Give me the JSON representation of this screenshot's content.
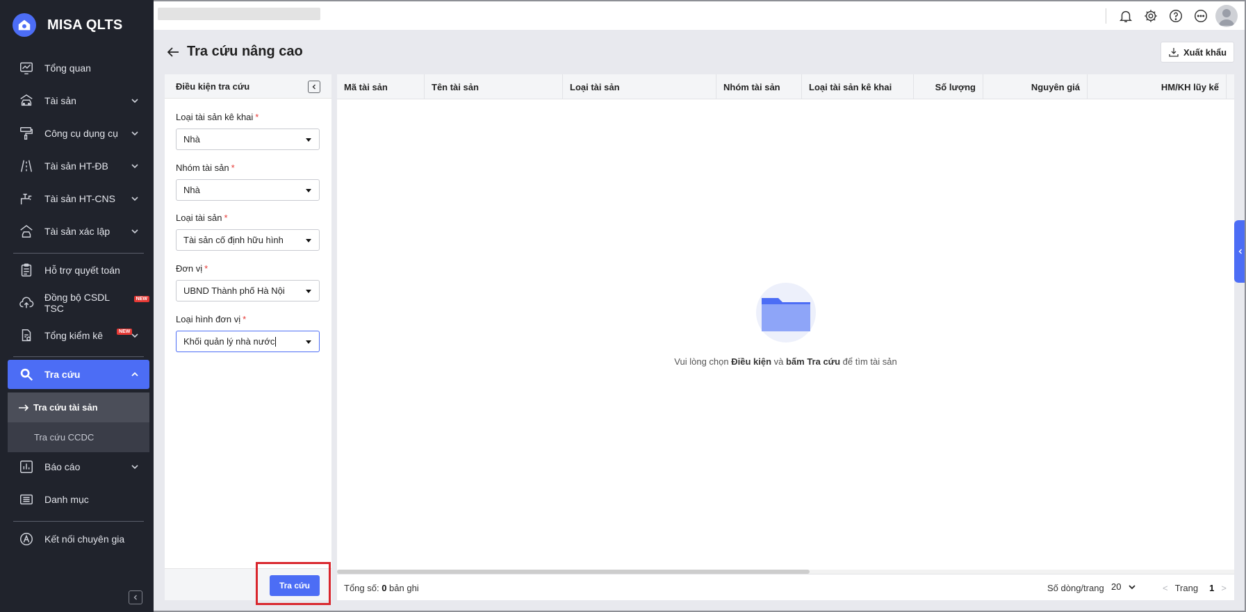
{
  "app": {
    "name": "MISA QLTS"
  },
  "sidebar": {
    "items": [
      {
        "label": "Tổng quan",
        "icon": "dashboard-icon"
      },
      {
        "label": "Tài sản",
        "icon": "car-house-icon"
      },
      {
        "label": "Công cụ dụng cụ",
        "icon": "paint-roller-icon"
      },
      {
        "label": "Tài sản HT-ĐB",
        "icon": "road-icon"
      },
      {
        "label": "Tài sản HT-CNS",
        "icon": "water-tap-icon"
      },
      {
        "label": "Tài sản xác lập",
        "icon": "house-car-icon"
      },
      {
        "label": "Hỗ trợ quyết toán",
        "icon": "clipboard-icon"
      },
      {
        "label": "Đồng bộ CSDL TSC",
        "icon": "cloud-upload-icon",
        "badge": "NEW"
      },
      {
        "label": "Tổng kiểm kê",
        "icon": "document-check-icon",
        "badge": "NEW"
      },
      {
        "label": "Tra cứu",
        "icon": "search-icon"
      },
      {
        "label": "Báo cáo",
        "icon": "bar-chart-icon"
      },
      {
        "label": "Danh mục",
        "icon": "list-icon"
      },
      {
        "label": "Kết nối chuyên gia",
        "icon": "expert-icon"
      }
    ],
    "sub_items": [
      {
        "label": "Tra cứu tài sản"
      },
      {
        "label": "Tra cứu CCDC"
      }
    ]
  },
  "page": {
    "title": "Tra cứu nâng cao",
    "export_label": "Xuất khẩu"
  },
  "filter": {
    "title": "Điều kiện tra cứu",
    "fields": [
      {
        "label": "Loại tài sản kê khai",
        "value": "Nhà"
      },
      {
        "label": "Nhóm tài sản",
        "value": "Nhà"
      },
      {
        "label": "Loại tài sản",
        "value": "Tài sản cố định hữu hình"
      },
      {
        "label": "Đơn vị",
        "value": "UBND Thành phố Hà Nội"
      },
      {
        "label": "Loại hình đơn vị",
        "value": "Khối quản lý nhà nước"
      }
    ],
    "required_mark": "*",
    "search_label": "Tra cứu"
  },
  "table": {
    "columns": [
      "Mã tài sản",
      "Tên tài sản",
      "Loại tài sản",
      "Nhóm tài sản",
      "Loại tài sản kê khai",
      "Số lượng",
      "Nguyên giá",
      "HM/KH lũy kế"
    ],
    "empty_prefix": "Vui lòng chọn ",
    "empty_bold_1": "Điều kiện",
    "empty_mid": " và ",
    "empty_bold_2": "bấm Tra cứu",
    "empty_suffix": " để tìm tài sản",
    "total_label": "Tổng số: ",
    "total_count": "0",
    "total_unit": " bản ghi",
    "rows_per_page_label": "Số dòng/trang",
    "rows_per_page_value": "20",
    "page_label": "Trang",
    "page_number": "1"
  },
  "colors": {
    "accent": "#4c6df5",
    "sidebar_bg": "#20232c",
    "highlight": "#d9262d"
  }
}
